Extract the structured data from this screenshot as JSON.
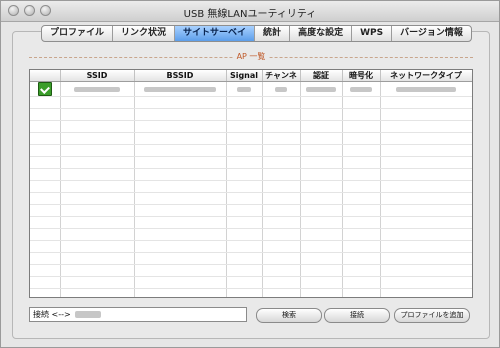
{
  "window": {
    "title": "USB 無線LANユーティリティ"
  },
  "tabs": [
    {
      "label": "プロファイル",
      "active": false
    },
    {
      "label": "リンク状況",
      "active": false
    },
    {
      "label": "サイトサーベイ",
      "active": true
    },
    {
      "label": "統計",
      "active": false
    },
    {
      "label": "高度な設定",
      "active": false
    },
    {
      "label": "WPS",
      "active": false
    },
    {
      "label": "バージョン情報",
      "active": false
    }
  ],
  "section": {
    "label": "AP 一覧"
  },
  "table": {
    "columns": [
      "",
      "SSID",
      "BSSID",
      "Signal",
      "チャンネ",
      "認証",
      "暗号化",
      "ネットワークタイプ"
    ],
    "rows": [
      {
        "status_icon": "connected-check-icon"
      }
    ],
    "empty_rows": 17
  },
  "connection": {
    "label": "接続 <-->"
  },
  "buttons": {
    "search": "検索",
    "connect": "接続",
    "add_profile": "プロファイルを追加"
  },
  "colors": {
    "active_tab": "#5d9eea",
    "section_label": "#c05a2a",
    "status_icon": "#3b9d2a"
  }
}
